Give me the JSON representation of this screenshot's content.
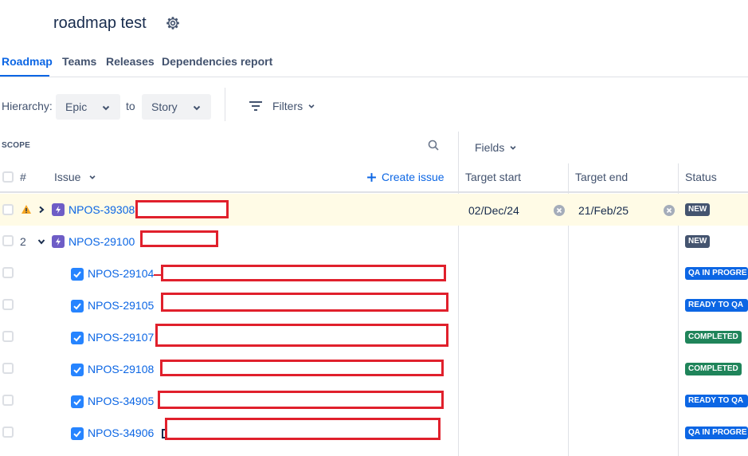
{
  "header": {
    "title": "roadmap test",
    "settings_icon": "gear-icon"
  },
  "tabs": [
    {
      "label": "Roadmap",
      "active": true
    },
    {
      "label": "Teams",
      "active": false
    },
    {
      "label": "Releases",
      "active": false
    },
    {
      "label": "Dependencies report",
      "active": false
    }
  ],
  "hierarchy": {
    "label": "Hierarchy:",
    "from": "Epic",
    "to_label": "to",
    "to": "Story"
  },
  "filters": {
    "label": "Filters"
  },
  "scope": {
    "label": "SCOPE",
    "search_icon": "search-icon"
  },
  "fields": {
    "label": "Fields"
  },
  "columns": {
    "hash": "#",
    "issue": "Issue",
    "create_issue": "Create issue",
    "target_start": "Target start",
    "target_end": "Target end",
    "status": "Status"
  },
  "rows": [
    {
      "num": "",
      "warning": true,
      "expand": "collapsed",
      "type": "epic",
      "key": "NPOS-39308",
      "target_start": "02/Dec/24",
      "target_end": "21/Feb/25",
      "status": "NEW"
    },
    {
      "num": "2",
      "warning": false,
      "expand": "expanded",
      "type": "epic",
      "key": "NPOS-29100",
      "target_start": "",
      "target_end": "",
      "status": "NEW"
    },
    {
      "num": "",
      "type": "story",
      "key": "NPOS-29104",
      "status": "QA IN PROGRE"
    },
    {
      "num": "",
      "type": "story",
      "key": "NPOS-29105",
      "status": "READY TO QA"
    },
    {
      "num": "",
      "type": "story",
      "key": "NPOS-29107",
      "status": "COMPLETED"
    },
    {
      "num": "",
      "type": "story",
      "key": "NPOS-29108",
      "status": "COMPLETED"
    },
    {
      "num": "",
      "type": "story",
      "key": "NPOS-34905",
      "status": "READY TO QA"
    },
    {
      "num": "",
      "type": "story",
      "key": "NPOS-34906",
      "status": "QA IN PROGRE"
    }
  ],
  "colors": {
    "accent": "#0c66e4",
    "epic": "#6e5dc6",
    "status_new": "#44546f",
    "status_in_progress": "#0c66e4",
    "status_done": "#1f845a",
    "highlight_row": "#fffbe6"
  }
}
